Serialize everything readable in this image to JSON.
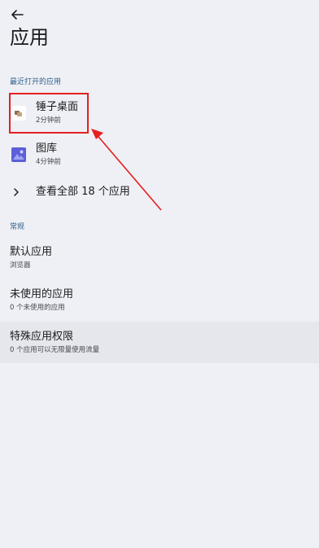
{
  "header": {
    "back_icon": "arrow-back-icon",
    "title": "应用"
  },
  "recent": {
    "label": "最近打开的应用",
    "apps": [
      {
        "name": "锤子桌面",
        "time": "2分钟前",
        "icon": "hammer-launcher-icon"
      },
      {
        "name": "图库",
        "time": "4分钟前",
        "icon": "gallery-icon"
      }
    ],
    "see_all": "查看全部 18 个应用"
  },
  "general": {
    "label": "常规",
    "items": [
      {
        "title": "默认应用",
        "subtitle": "浏览器"
      },
      {
        "title": "未使用的应用",
        "subtitle": "0 个未使用的应用"
      },
      {
        "title": "特殊应用权限",
        "subtitle": "0 个应用可以无限量使用流量"
      }
    ]
  },
  "annotation": {
    "color": "#e42020"
  }
}
